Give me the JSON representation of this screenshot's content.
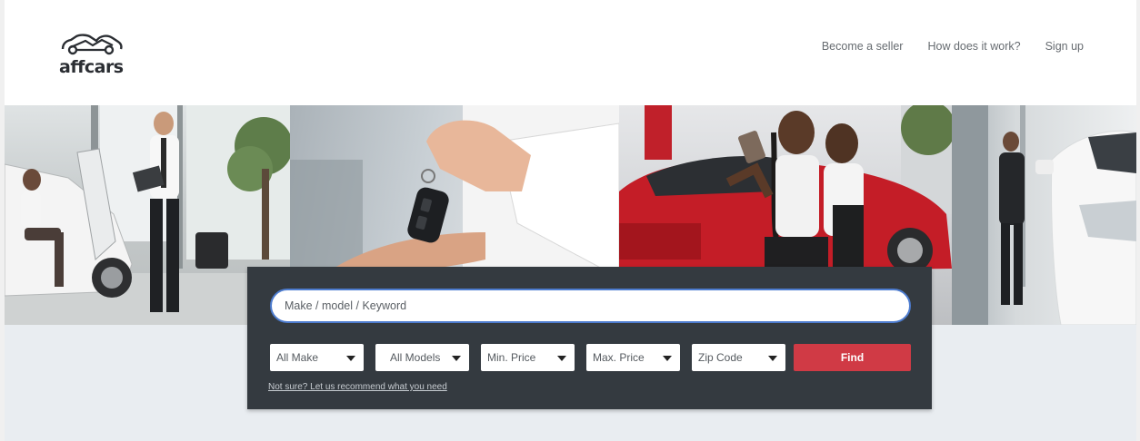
{
  "header": {
    "logo_text": "affcars",
    "nav": [
      {
        "label": "Become a seller"
      },
      {
        "label": "How does it work?"
      },
      {
        "label": "Sign up"
      }
    ]
  },
  "hero": {
    "panels": [
      {
        "name": "hero-photo-showroom"
      },
      {
        "name": "hero-photo-key-handover"
      },
      {
        "name": "hero-photo-selfie-red-car"
      },
      {
        "name": "hero-photo-white-car"
      }
    ]
  },
  "search": {
    "placeholder": "Make / model / Keyword",
    "filters": {
      "make": "All Make",
      "models": "All Models",
      "min_price": "Min. Price",
      "max_price": "Max. Price",
      "zip": "Zip Code"
    },
    "find_label": "Find",
    "recommend_link": "Not sure? Let us recommend what you need"
  },
  "colors": {
    "accent_red": "#d03a45",
    "panel_dark": "#343a40",
    "input_border": "#4d7ccf",
    "background": "#e9edf1"
  }
}
